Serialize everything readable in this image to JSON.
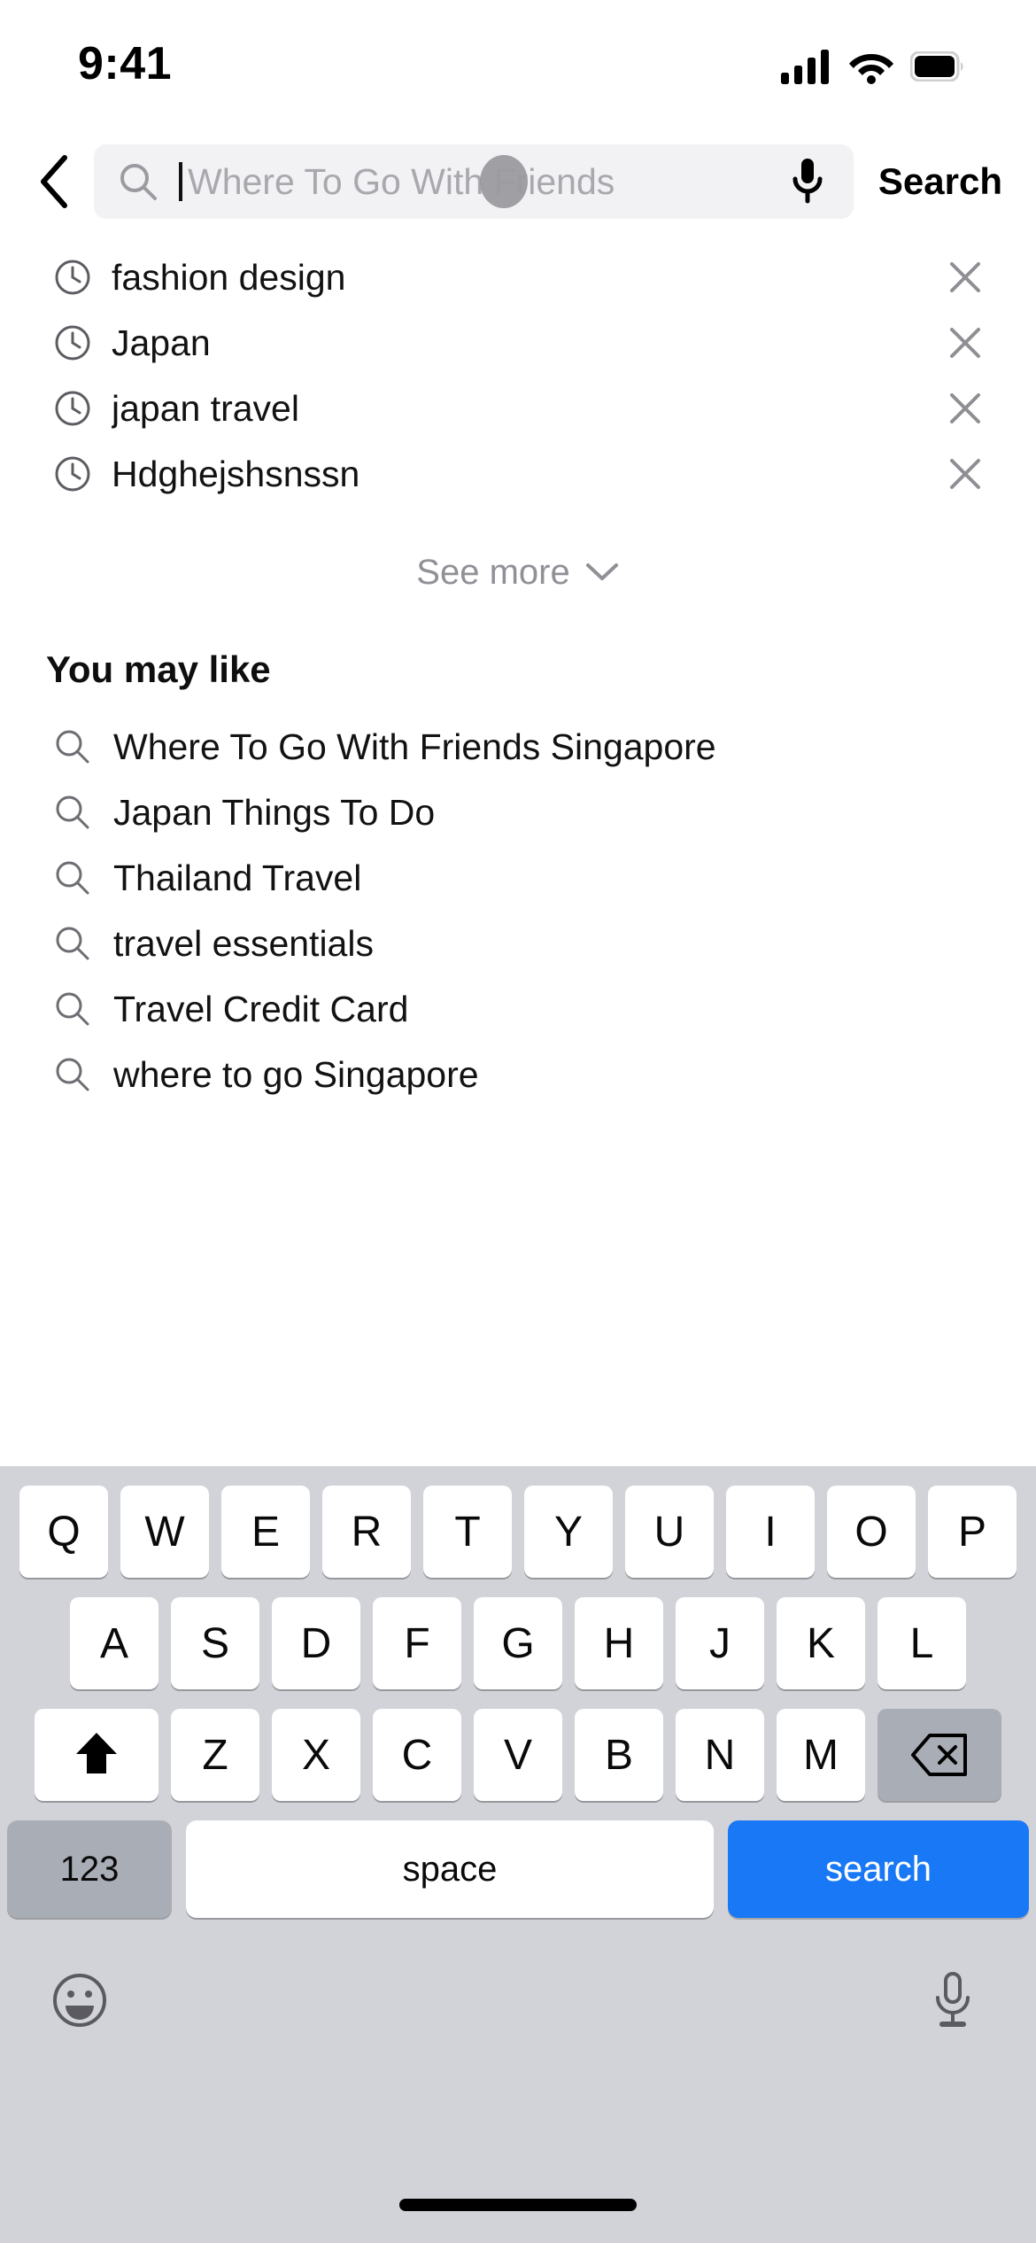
{
  "status_bar": {
    "time": "9:41",
    "icons": [
      "cellular-signal-icon",
      "wifi-icon",
      "battery-icon"
    ]
  },
  "search_header": {
    "back_icon": "chevron-left-icon",
    "search_icon": "search-icon",
    "input_value": "",
    "placeholder": "Where To Go With Friends",
    "mic_icon": "microphone-icon",
    "action_label": "Search",
    "touch_indicator": "touch-point-indicator"
  },
  "history": {
    "item_icon": "clock-icon",
    "clear_icon": "close-icon",
    "items": [
      {
        "label": "fashion design"
      },
      {
        "label": "Japan"
      },
      {
        "label": "japan travel"
      },
      {
        "label": "Hdghejshsnssn"
      }
    ],
    "see_more_label": "See more",
    "see_more_icon": "chevron-down-icon"
  },
  "suggestions": {
    "title": "You may like",
    "item_icon": "search-icon",
    "items": [
      {
        "label": "Where To Go With Friends Singapore"
      },
      {
        "label": "Japan Things To Do"
      },
      {
        "label": "Thailand Travel"
      },
      {
        "label": "travel essentials"
      },
      {
        "label": "Travel Credit Card"
      },
      {
        "label": "where to go Singapore"
      }
    ]
  },
  "keyboard": {
    "row1": [
      "Q",
      "W",
      "E",
      "R",
      "T",
      "Y",
      "U",
      "I",
      "O",
      "P"
    ],
    "row2": [
      "A",
      "S",
      "D",
      "F",
      "G",
      "H",
      "J",
      "K",
      "L"
    ],
    "row3": [
      "Z",
      "X",
      "C",
      "V",
      "B",
      "N",
      "M"
    ],
    "shift_icon": "shift-arrow-icon",
    "backspace_icon": "backspace-icon",
    "numbers_label": "123",
    "space_label": "space",
    "search_label": "search",
    "emoji_icon": "emoji-smiley-icon",
    "dictation_icon": "microphone-icon",
    "accent_color": "#1878f5",
    "background_color": "#d1d3d9",
    "key_color": "#ffffff",
    "modifier_key_color": "#a9adb6"
  }
}
